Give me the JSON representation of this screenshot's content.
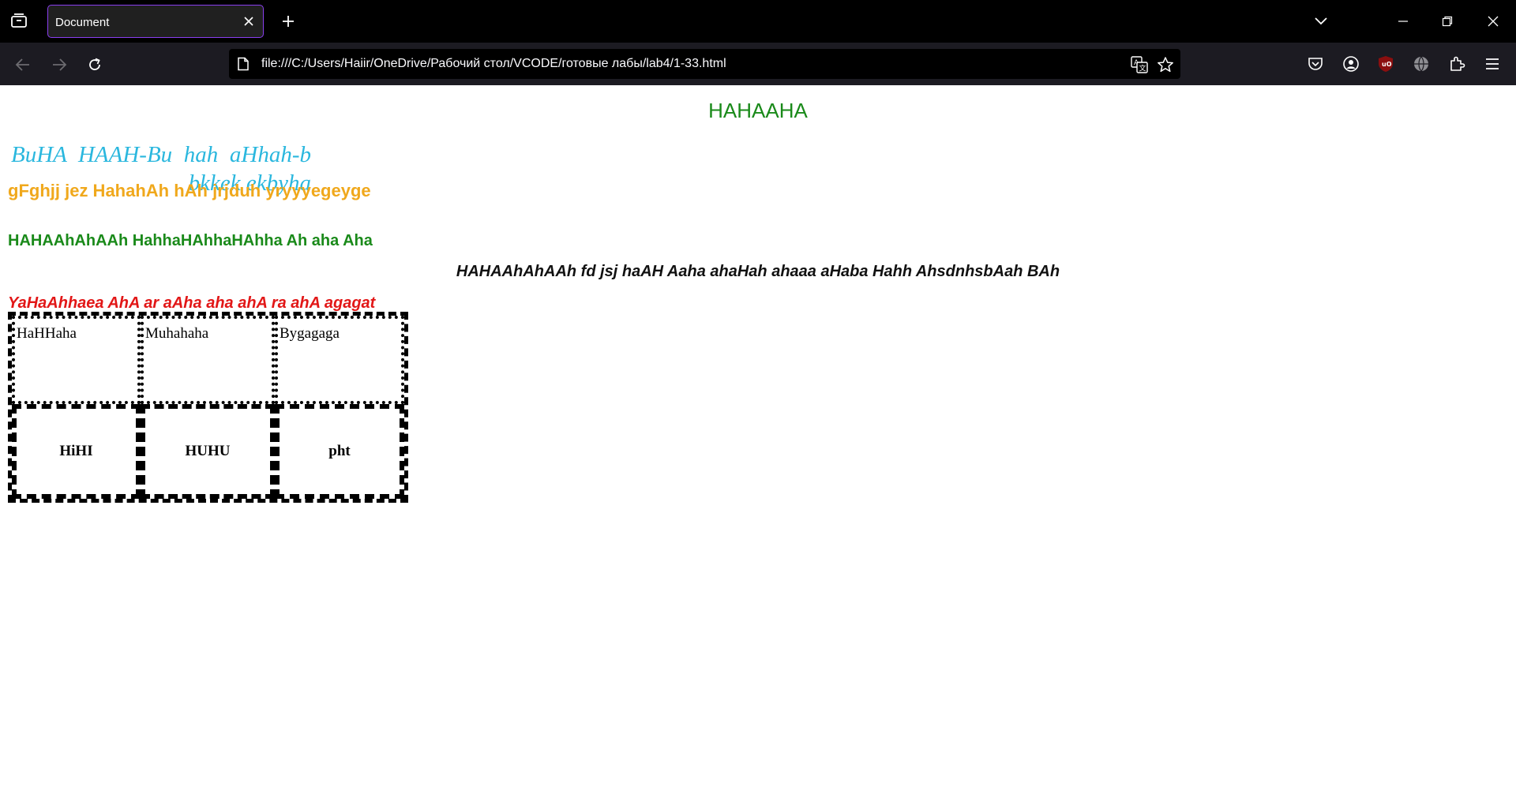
{
  "browser": {
    "tab_title": "Document",
    "url": "file:///C:/Users/Haiir/OneDrive/Рабочий стол/VCODE/готовые лабы/lab4/1-33.html"
  },
  "page": {
    "heading": "HAHAAHA",
    "cyan_text": "BuHA HAAH-Bu hah aHhah-b bkkek ekbyha",
    "orange_text": "gFghjj jez HahahAh hAh jrjduh yryyyegeyge",
    "green_text": "HAHAAhAhAAh HahhaHAhhaHAhha Ah aha Aha",
    "black_italic_text": "HAHAAhAhAAh fd jsj haAH Aaha ahaHah ahaaa aHaba Hahh AhsdnhsbAah BAh",
    "red_text": "YaHaAhhaea AhA ar aAha aha ahA ra ahA agagat",
    "table": {
      "row1": [
        "HaHHaha",
        "Muhahaha",
        "Bygagaga"
      ],
      "row2": [
        "HiHI",
        "HUHU",
        "pht"
      ]
    }
  },
  "colors": {
    "heading_green": "#1a8a1a",
    "cyan": "#2ab7de",
    "orange": "#f0a81c",
    "red": "#e21717",
    "tab_outline": "#8a3ff0"
  },
  "icons": [
    "tab-list-icon",
    "close-icon",
    "plus-icon",
    "chevron-down-icon",
    "minimize-icon",
    "restore-icon",
    "window-close-icon",
    "back-arrow-icon",
    "forward-arrow-icon",
    "reload-icon",
    "page-icon",
    "translate-icon",
    "star-icon",
    "pocket-icon",
    "account-icon",
    "ublock-icon",
    "globe-icon",
    "extensions-icon",
    "hamburger-menu-icon"
  ]
}
